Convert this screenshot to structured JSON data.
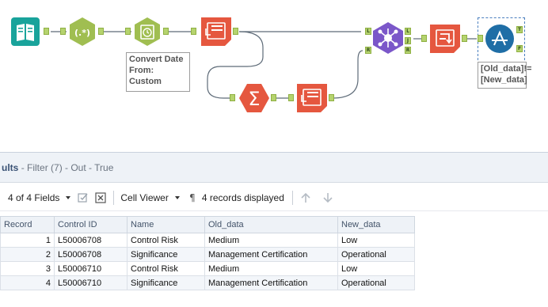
{
  "canvas": {
    "tools": [
      {
        "name": "input-data-tool",
        "icon": "book-icon",
        "color": "#19a39b"
      },
      {
        "name": "regex-tool",
        "icon": "regex-icon",
        "label": "(.*)",
        "color": "#a0be51"
      },
      {
        "name": "datetime-tool",
        "icon": "clock-icon",
        "color": "#a0be51"
      },
      {
        "name": "select-tool-1",
        "icon": "select-icon",
        "color": "#e5573f"
      },
      {
        "name": "summarize-tool",
        "icon": "sigma-icon",
        "label": "Σ",
        "color": "#e5573f"
      },
      {
        "name": "select-tool-2",
        "icon": "select-icon",
        "color": "#e5573f"
      },
      {
        "name": "join-tool",
        "icon": "join-icon",
        "color": "#7b57c9"
      },
      {
        "name": "transpose-tool",
        "icon": "transpose-icon",
        "color": "#e5573f"
      },
      {
        "name": "filter-tool",
        "icon": "filter-icon",
        "color": "#1f6ea6"
      }
    ],
    "anchors": {
      "join_left": "L",
      "join_right": "R",
      "join_out_left": "L",
      "join_out_join": "J",
      "join_out_right": "R",
      "filter_true": "T",
      "filter_false": "F"
    },
    "annotations": {
      "datetime": "Convert Date\nFrom:\nCustom",
      "filter": "[Old_data]!=\n[New_data]"
    }
  },
  "results": {
    "title": "ults",
    "subtitle": "- Filter (7) - Out - True",
    "toolbar": {
      "fields": "4 of 4 Fields",
      "viewer": "Cell Viewer",
      "records": "4 records displayed"
    },
    "columns": [
      "Record",
      "Control ID",
      "Name",
      "Old_data",
      "New_data"
    ],
    "rows": [
      [
        "1",
        "L50006708",
        "Control Risk",
        "Medium",
        "Low"
      ],
      [
        "2",
        "L50006708",
        "Significance",
        "Management Certification",
        "Operational"
      ],
      [
        "3",
        "L50006710",
        "Control Risk",
        "Medium",
        "Low"
      ],
      [
        "4",
        "L50006710",
        "Significance",
        "Management Certification",
        "Operational"
      ]
    ]
  },
  "colors": {
    "anchor_green": "#b5d36e",
    "header_bg": "#eef2f7",
    "title_blue": "#3a5275"
  }
}
